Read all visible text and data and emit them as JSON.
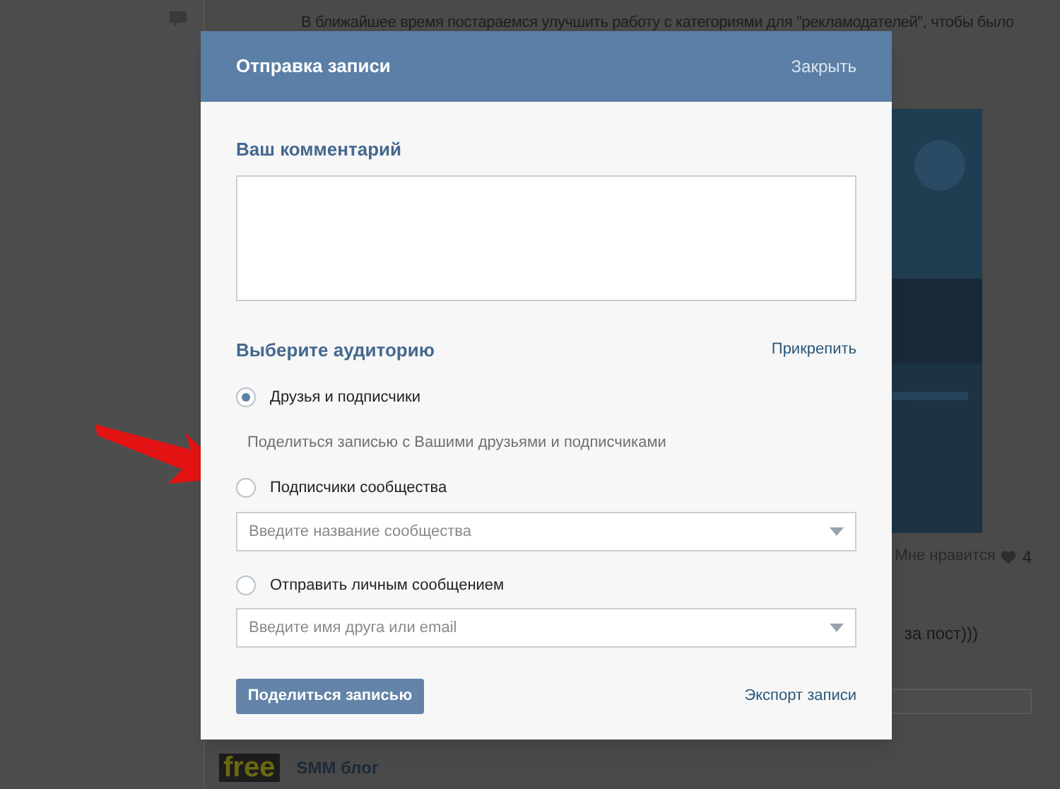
{
  "background": {
    "post_text": "В ближайшее время постараемся улучшить работу с категориями для \"рекламодателей\", чтобы было",
    "likes_label": "Мне нравится",
    "likes_count": "4",
    "comment_text": "за пост)))",
    "blog_logo": "free",
    "blog_name": "SMM блог"
  },
  "modal": {
    "title": "Отправка записи",
    "close": "Закрыть",
    "comment_label": "Ваш комментарий",
    "audience_label": "Выберите аудиторию",
    "attach": "Прикрепить",
    "options": [
      {
        "label": "Друзья и подписчики",
        "selected": true,
        "description": "Поделиться записью с Вашими друзьями и подписчиками"
      },
      {
        "label": "Подписчики сообщества",
        "selected": false,
        "placeholder": "Введите название сообщества"
      },
      {
        "label": "Отправить личным сообщением",
        "selected": false,
        "placeholder": "Введите имя друга или email"
      }
    ],
    "share_button": "Поделиться записью",
    "export": "Экспорт записи"
  }
}
